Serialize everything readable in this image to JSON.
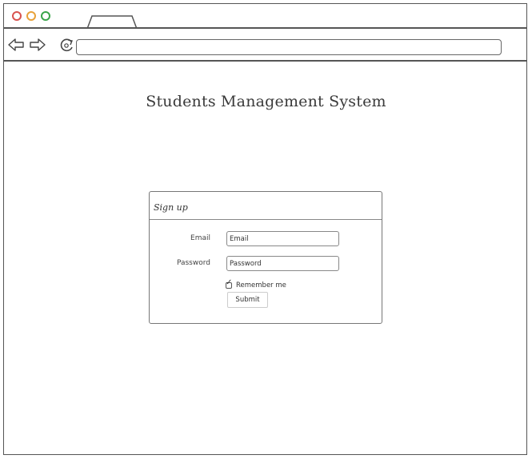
{
  "browser": {
    "controls": {
      "close_icon": "circle-red",
      "minimize_icon": "circle-orange",
      "maximize_icon": "circle-green"
    },
    "url": ""
  },
  "page": {
    "title": "Students Management System"
  },
  "signup": {
    "heading": "Sign up",
    "email_label": "Email",
    "email_value": "Email",
    "password_label": "Password",
    "password_value": "Password",
    "remember_label": "Remember me",
    "remember_checked": true,
    "submit_label": "Submit"
  },
  "colors": {
    "close": "#d9534f",
    "minimize": "#e8a23a",
    "maximize": "#3aa54a",
    "border": "#555555"
  }
}
